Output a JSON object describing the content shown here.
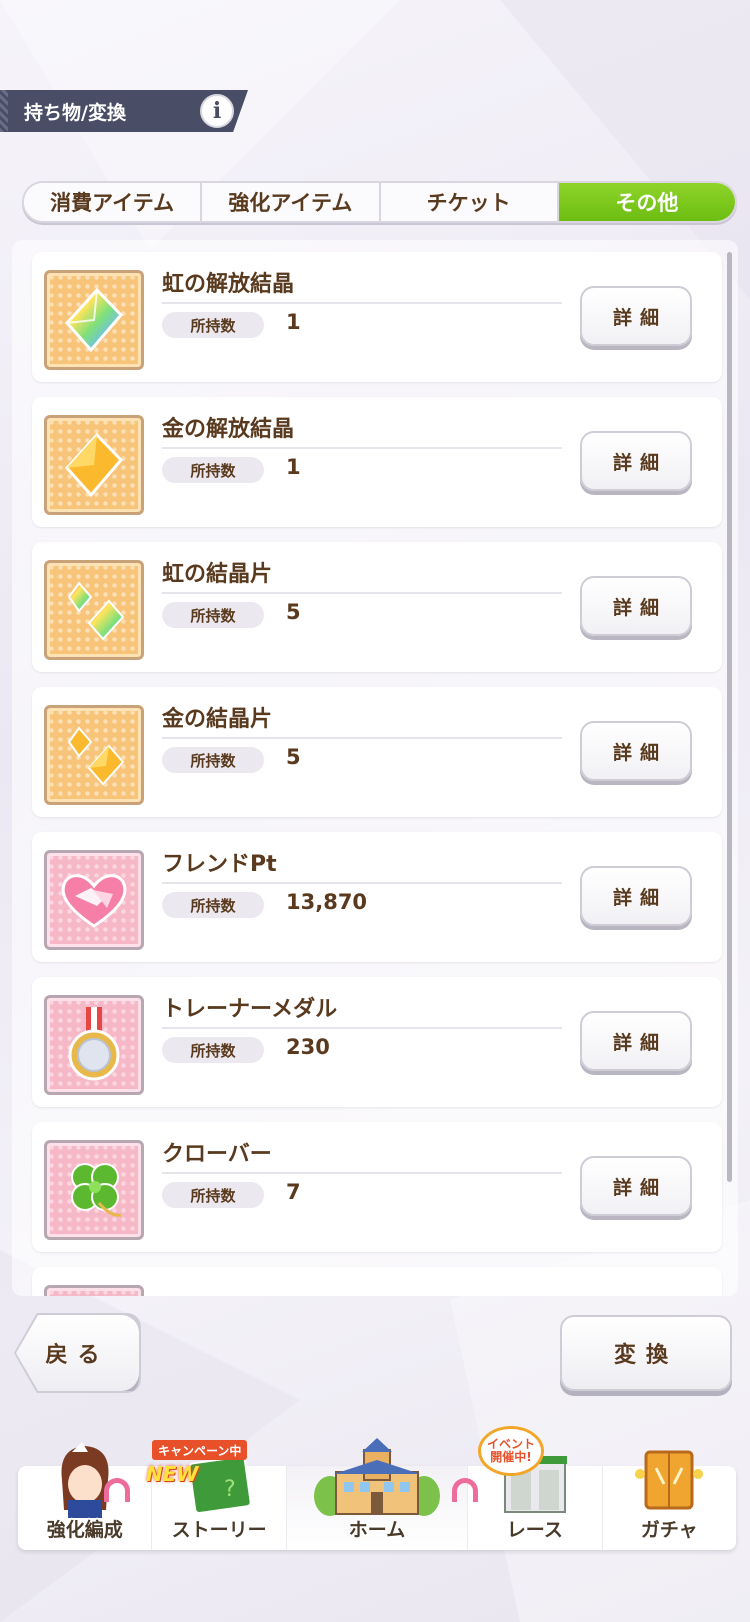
{
  "header": {
    "title": "持ち物/変換",
    "info_icon": "i"
  },
  "tabs": [
    {
      "label": "消費アイテム",
      "active": false
    },
    {
      "label": "強化アイテム",
      "active": false
    },
    {
      "label": "チケット",
      "active": false
    },
    {
      "label": "その他",
      "active": true
    }
  ],
  "items": [
    {
      "name": "虹の解放結晶",
      "qty_label": "所持数",
      "qty": "1",
      "icon": "rainbow-crystal-icon",
      "detail": "詳細"
    },
    {
      "name": "金の解放結晶",
      "qty_label": "所持数",
      "qty": "1",
      "icon": "gold-crystal-icon",
      "detail": "詳細"
    },
    {
      "name": "虹の結晶片",
      "qty_label": "所持数",
      "qty": "5",
      "icon": "rainbow-shard-icon",
      "detail": "詳細"
    },
    {
      "name": "金の結晶片",
      "qty_label": "所持数",
      "qty": "5",
      "icon": "gold-shard-icon",
      "detail": "詳細"
    },
    {
      "name": "フレンドPt",
      "qty_label": "所持数",
      "qty": "13,870",
      "icon": "handshake-icon",
      "detail": "詳細"
    },
    {
      "name": "トレーナーメダル",
      "qty_label": "所持数",
      "qty": "230",
      "icon": "medal-icon",
      "detail": "詳細"
    },
    {
      "name": "クローバー",
      "qty_label": "所持数",
      "qty": "7",
      "icon": "clover-icon",
      "detail": "詳細"
    }
  ],
  "buttons": {
    "back": "戻る",
    "convert": "変換"
  },
  "nav": {
    "items": [
      {
        "label": "強化編成",
        "icon": "character-portrait-icon"
      },
      {
        "label": "ストーリー",
        "icon": "story-book-icon"
      },
      {
        "label": "ホーム",
        "icon": "school-building-icon"
      },
      {
        "label": "レース",
        "icon": "race-gate-icon"
      },
      {
        "label": "ガチャ",
        "icon": "gacha-door-icon"
      }
    ],
    "campaign_badge": "キャンペーン中",
    "new_badge": "NEW",
    "event_badge_line1": "イベント",
    "event_badge_line2": "開催中!"
  },
  "colors": {
    "active_tab": "#7cc81c",
    "text_brown": "#5a3a1e",
    "header_bg": "#4a4d66"
  }
}
